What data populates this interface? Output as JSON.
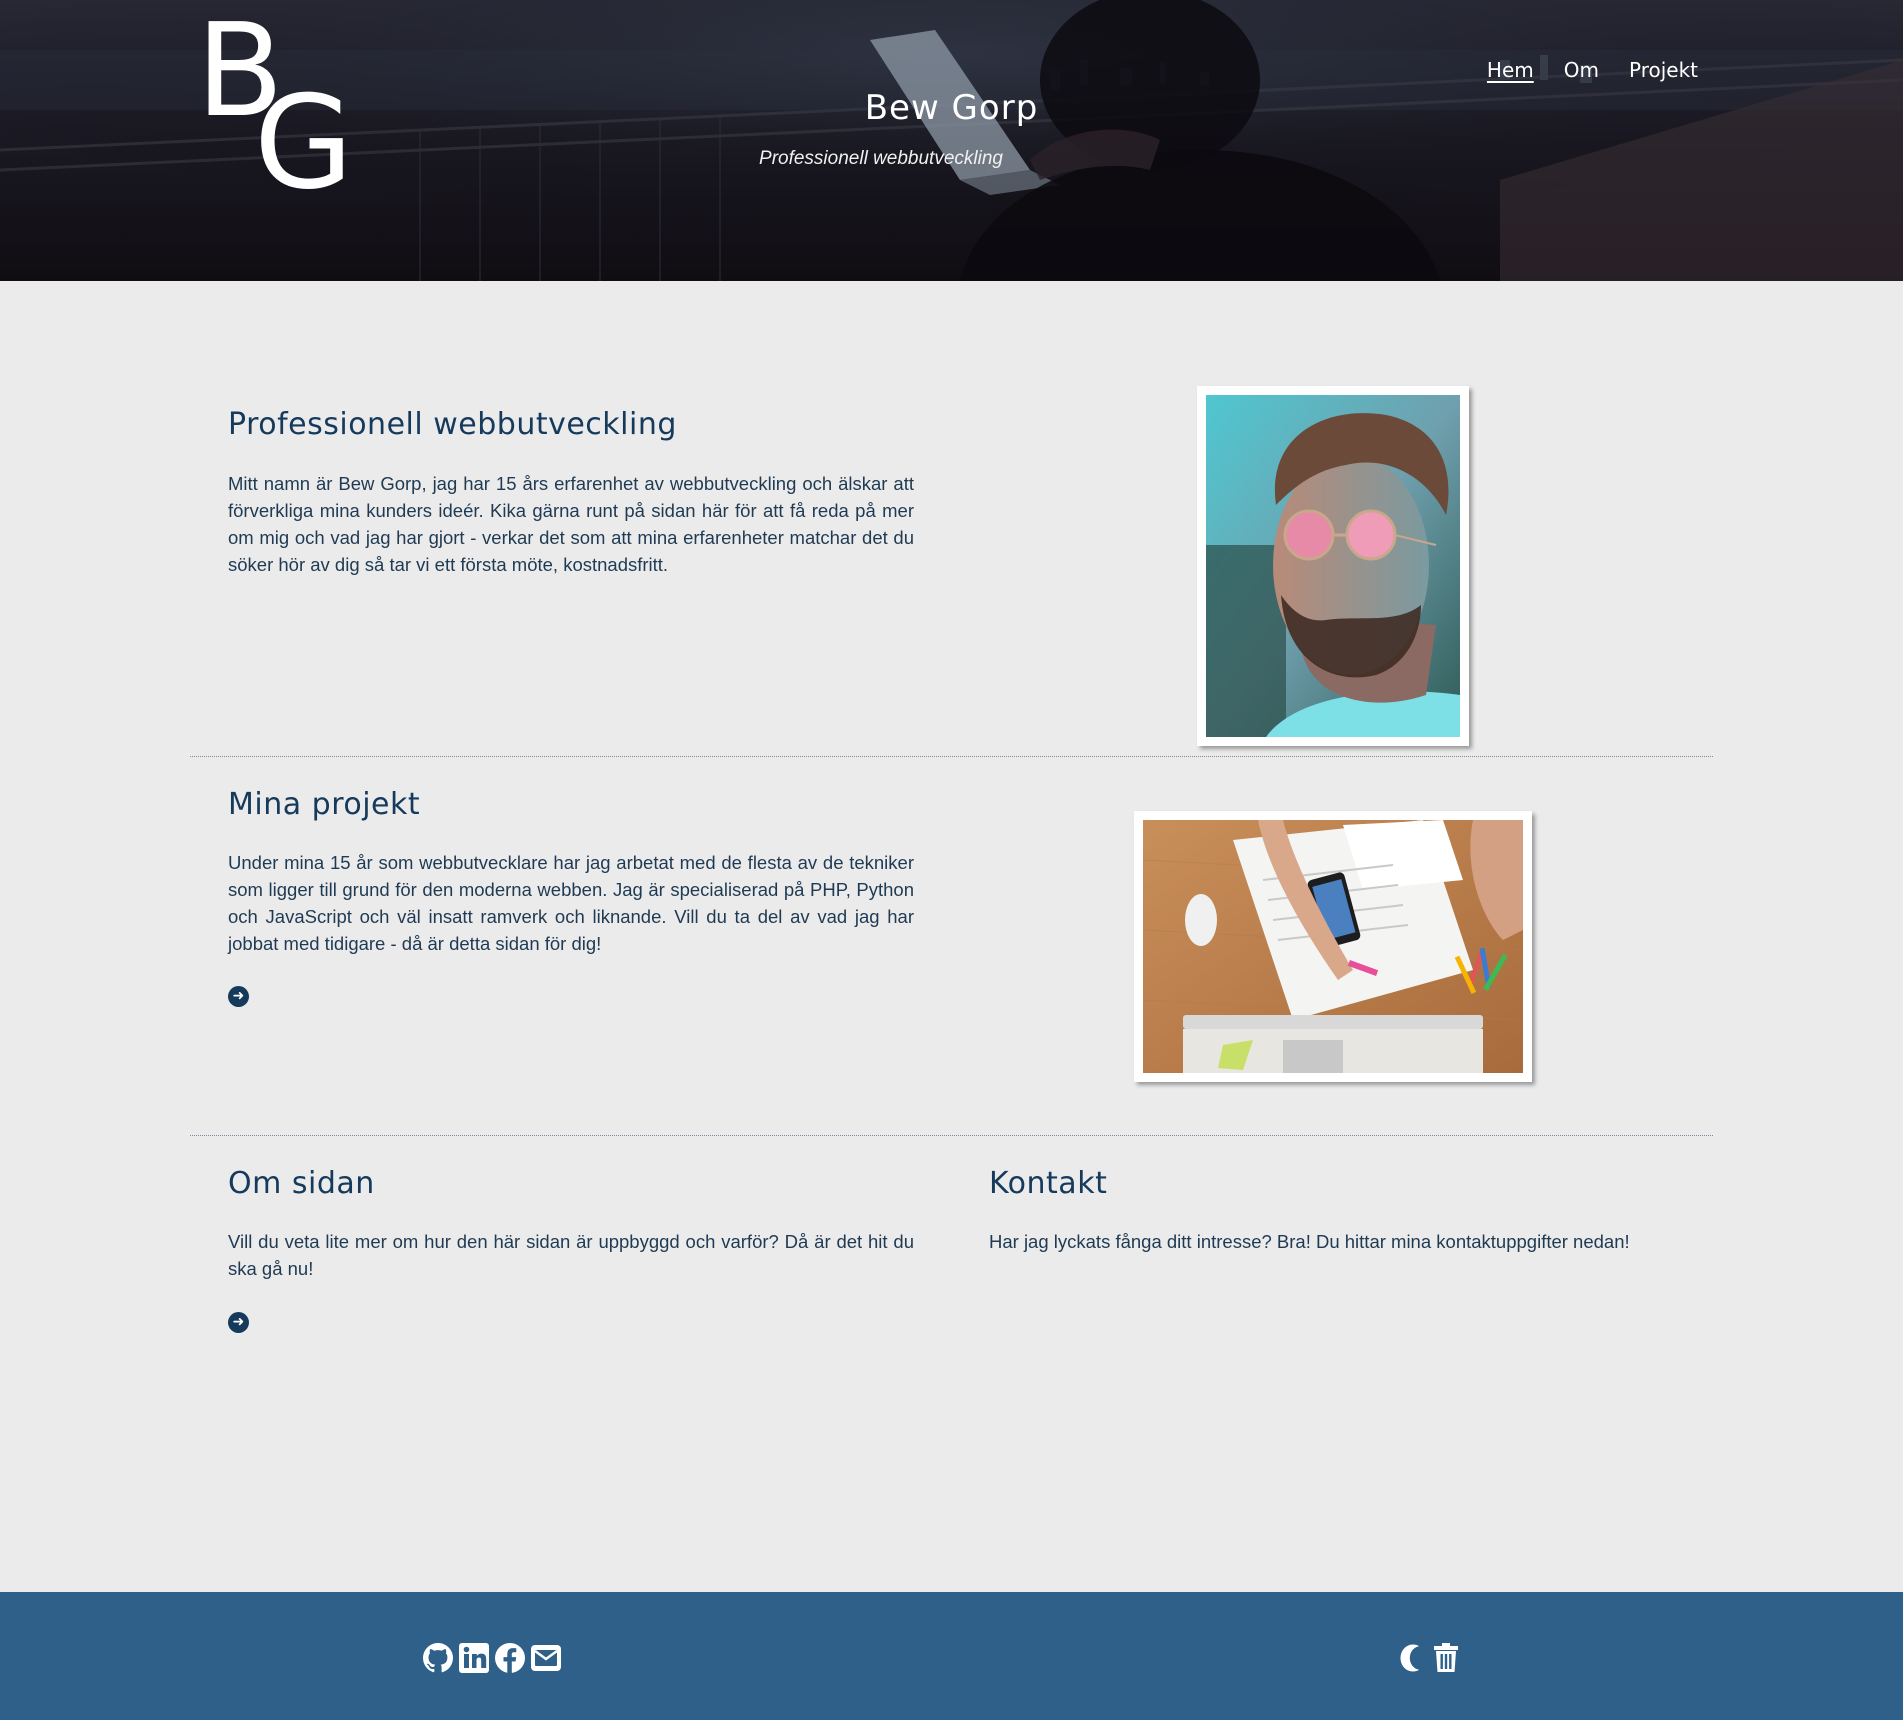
{
  "header": {
    "logo_letters": [
      "B",
      "G"
    ],
    "site_title": "Bew Gorp",
    "subtitle": "Professionell webbutveckling",
    "nav": [
      {
        "label": "Hem",
        "active": true
      },
      {
        "label": "Om",
        "active": false
      },
      {
        "label": "Projekt",
        "active": false
      }
    ]
  },
  "sections": {
    "intro": {
      "title": "Professionell webbutveckling",
      "text": "Mitt namn är Bew Gorp, jag har 15 års erfarenhet av webbutveckling och älskar att förverkliga mina kunders ideér. Kika gärna runt på sidan här för att få reda på mer om mig och vad jag har gjort - verkar det som att mina erfarenheter matchar det du söker hör av dig så tar vi ett första möte, kostnadsfritt."
    },
    "projects": {
      "title": "Mina projekt",
      "text": "Under mina 15 år som webbutvecklare har jag arbetat med de flesta av de tekniker som ligger till grund för den moderna webben. Jag är specialiserad på PHP, Python och JavaScript och väl insatt ramverk och liknande. Vill du ta del av vad jag har jobbat med tidigare - då är detta sidan för dig!",
      "arrow_icon": "arrow-circle-right-icon"
    },
    "about": {
      "title": "Om sidan",
      "text": "Vill du veta lite mer om hur den här sidan är uppbyggd och varför? Då är det hit du ska gå nu!",
      "arrow_icon": "arrow-circle-right-icon"
    },
    "contact": {
      "title": "Kontakt",
      "text": "Har jag lyckats fånga ditt intresse? Bra! Du hittar mina kontaktuppgifter nedan!"
    }
  },
  "footer": {
    "social_icons": [
      "github-icon",
      "linkedin-icon",
      "facebook-icon",
      "envelope-icon"
    ],
    "tool_icons": [
      "moon-icon",
      "trash-icon"
    ]
  },
  "colors": {
    "page_bg": "#ebebeb",
    "heading": "#163a5c",
    "text": "#1f3a52",
    "footer_bg": "#2e6089",
    "hero_bg": "#17151d"
  }
}
